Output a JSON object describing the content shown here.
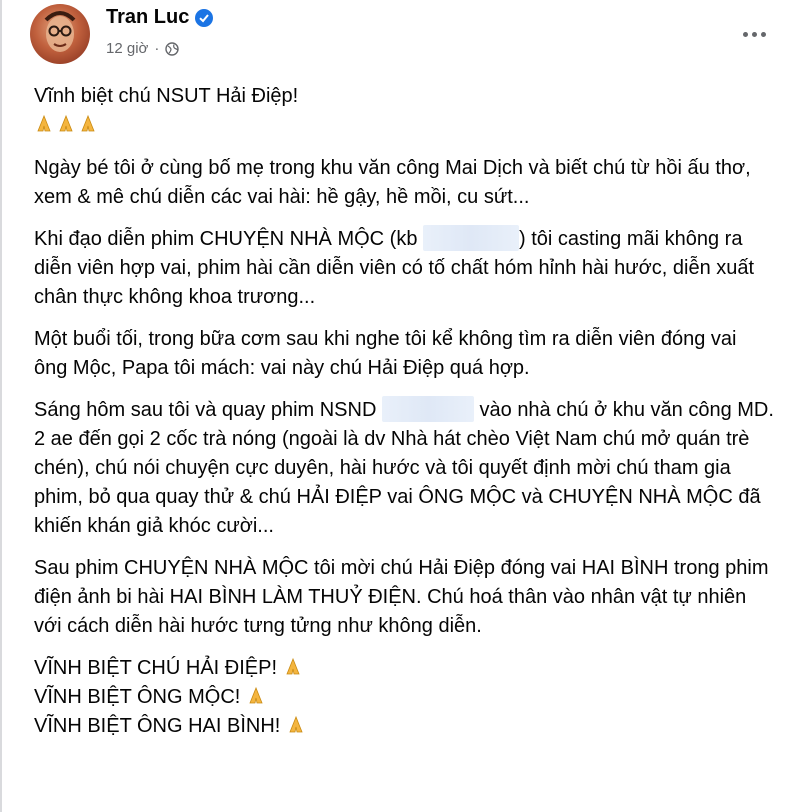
{
  "post": {
    "author": "Tran Luc",
    "time": "12 giờ",
    "paragraphs": {
      "title": "Vĩnh biệt chú NSUT Hải Điệp!",
      "p1": "Ngày bé tôi ở cùng bố mẹ trong khu văn công Mai Dịch và biết chú từ hồi ấu thơ, xem & mê chú diễn các vai hài: hề gậy, hề mồi, cu sứt...",
      "p2a": "Khi đạo diễn phim CHUYỆN NHÀ MỘC (kb ",
      "p2b": ") tôi casting mãi không ra diễn viên hợp vai, phim hài cần diễn viên có tố chất hóm hỉnh hài hước, diễn xuất chân thực không khoa trương...",
      "p3": "Một buổi tối, trong bữa cơm sau khi nghe tôi kể không tìm ra diễn viên đóng vai ông Mộc, Papa tôi mách: vai này chú Hải Điệp quá hợp.",
      "p4a": "Sáng hôm sau tôi và quay phim NSND ",
      "p4b": " vào nhà chú ở khu văn công MD. 2 ae đến gọi 2 cốc trà nóng (ngoài là dv Nhà hát chèo Việt Nam chú mở quán trè chén), chú nói chuyện cực duyên, hài hước và tôi quyết định mời chú tham gia phim, bỏ qua quay thử & chú HẢI ĐIỆP vai ÔNG MỘC và CHUYỆN NHÀ MỘC đã khiến khán giả khóc cười...",
      "p5": "Sau phim CHUYỆN NHÀ MỘC tôi mời chú Hải Điệp đóng vai HAI BÌNH trong phim điện ảnh bi hài HAI BÌNH LÀM THUỶ ĐIỆN. Chú hoá thân vào nhân vật tự nhiên với cách diễn hài hước tưng tửng như không diễn.",
      "end1": "VĨNH BIỆT CHÚ HẢI ĐIỆP! ",
      "end2": "VĨNH BIỆT ÔNG MỘC! ",
      "end3": "VĨNH BIỆT ÔNG HAI BÌNH! "
    },
    "icons": {
      "verified": "verified-badge-icon",
      "privacy": "globe-icon",
      "menu": "more-options-icon",
      "emoji": "folded-hands-emoji"
    },
    "colors": {
      "verified": "#1b74e4",
      "meta": "#65676b"
    }
  }
}
